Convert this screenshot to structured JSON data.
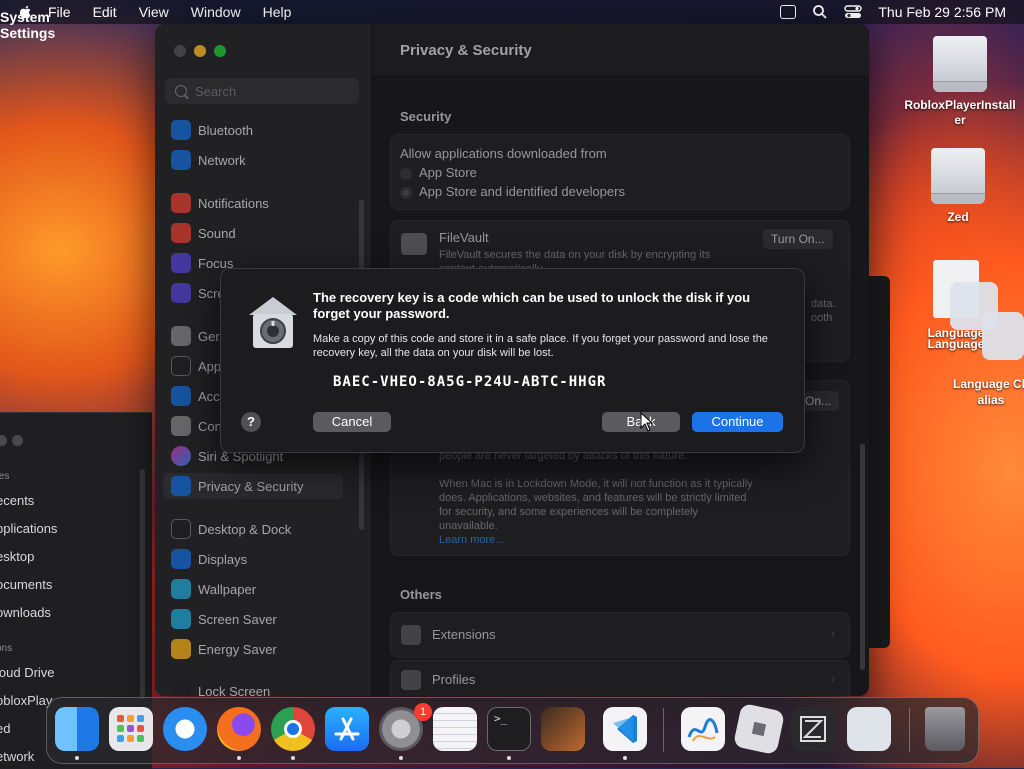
{
  "menubar": {
    "app_name": "System Settings",
    "items": [
      "File",
      "Edit",
      "View",
      "Window",
      "Help"
    ],
    "datetime": "Thu Feb 29  2:56 PM"
  },
  "finder": {
    "header_favorites": "tes",
    "items": [
      "ecents",
      "pplications",
      "esktop",
      "ocuments",
      "ownloads"
    ],
    "header_locations": "ons",
    "locations": [
      "loud Drive",
      "obloxPlay",
      "ed",
      "etwork"
    ]
  },
  "settings": {
    "search_placeholder": "Search",
    "sidebar": [
      {
        "label": "Bluetooth",
        "color": "#1e6fd6"
      },
      {
        "label": "Network",
        "color": "#1e6fd6"
      },
      {
        "label": "Notifications",
        "color": "#e0443a"
      },
      {
        "label": "Sound",
        "color": "#e0443a"
      },
      {
        "label": "Focus",
        "color": "#5b4ad6"
      },
      {
        "label": "Scre",
        "color": "#5b4ad6"
      },
      {
        "label": "Gen",
        "color": "#8a8a8e"
      },
      {
        "label": "App",
        "color": "#2a2a2d"
      },
      {
        "label": "Acc",
        "color": "#1e6fd6"
      },
      {
        "label": "Con",
        "color": "#8a8a8e"
      },
      {
        "label": "Siri & Spotlight",
        "color": "#b03ad6"
      },
      {
        "label": "Privacy & Security",
        "color": "#1e6fd6"
      },
      {
        "label": "Desktop & Dock",
        "color": "#2a2a2d"
      },
      {
        "label": "Displays",
        "color": "#1e6fd6"
      },
      {
        "label": "Wallpaper",
        "color": "#2aa7d6"
      },
      {
        "label": "Screen Saver",
        "color": "#2aa7d6"
      },
      {
        "label": "Energy Saver",
        "color": "#f0b020"
      },
      {
        "label": "Lock Screen",
        "color": "#2a2a2d"
      }
    ],
    "selected": "Privacy & Security",
    "page_title": "Privacy & Security",
    "security_label": "Security",
    "allow_label": "Allow applications downloaded from",
    "options": [
      "App Store",
      "App Store and identified developers"
    ],
    "filevault_title": "FileVault",
    "filevault_desc": "FileVault secures the data on your disk by encrypting its content automatically.",
    "turn_on": "Turn On...",
    "partial_right": [
      "data.",
      "ooth"
    ],
    "turn_on_2": "On...",
    "lockdown_text_1": "people are never targeted by attacks of this nature.",
    "lockdown_text_2": "When Mac is in Lockdown Mode, it will not function as it typically does. Applications, websites, and features will be strictly limited for security, and some experiences will be completely unavailable.",
    "learn_more": "Learn more...",
    "others_label": "Others",
    "extensions": "Extensions",
    "profiles": "Profiles"
  },
  "dialog": {
    "title": "The recovery key is a code which can be used to unlock the disk if you forget your password.",
    "body": "Make a copy of this code and store it in a safe place. If you forget your password and lose the recovery key, all the data on your disk will be lost.",
    "recovery_key": "BAEC-VHEO-8A5G-P24U-ABTC-HHGR",
    "help": "?",
    "cancel": "Cancel",
    "back": "Back",
    "continue": "Continue"
  },
  "desktop": {
    "icons": [
      {
        "label": "RobloxPlayerInstaller"
      },
      {
        "label": "Zed"
      },
      {
        "label": "Language"
      },
      {
        "label": "Language Ch alias"
      }
    ],
    "language_overlap": "Language"
  },
  "dock": {
    "apps": [
      {
        "name": "Finder",
        "color": "#2f8cf0"
      },
      {
        "name": "Launchpad",
        "color": "#e8e8ea"
      },
      {
        "name": "Safari",
        "color": "#2a8ef0"
      },
      {
        "name": "Firefox",
        "color": "#f5701c"
      },
      {
        "name": "Chrome",
        "color": "#e8e8ea"
      },
      {
        "name": "App Store",
        "color": "#1a8cf0"
      },
      {
        "name": "System Settings",
        "color": "#8e8e93"
      },
      {
        "name": "TextEdit",
        "color": "#f4f4f6"
      },
      {
        "name": "Terminal",
        "color": "#1e1e20"
      },
      {
        "name": "GarageBand",
        "color": "#6a4a3a"
      },
      {
        "name": "Visual Studio Code",
        "color": "#f4f4f6"
      },
      {
        "name": "Freeform",
        "color": "#f4f4f6"
      },
      {
        "name": "Roblox",
        "color": "#e0e0e4"
      },
      {
        "name": "Zed",
        "color": "#2a2a2d"
      },
      {
        "name": "Preview",
        "color": "#dfe3ea"
      },
      {
        "name": "Trash",
        "color": "#6a6a70"
      }
    ],
    "settings_badge": "1"
  }
}
